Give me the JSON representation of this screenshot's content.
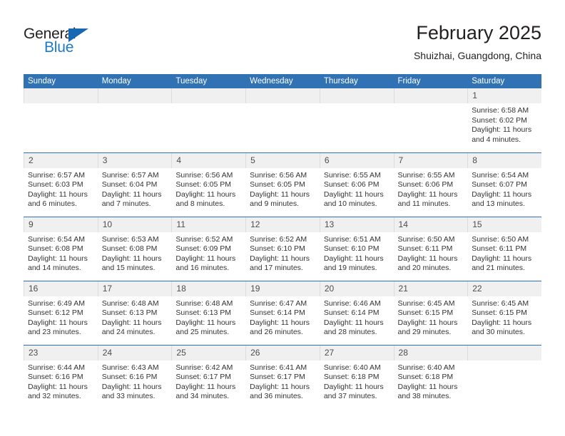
{
  "logo": {
    "word1": "General",
    "word2": "Blue",
    "triangle_color": "#1668b3",
    "blue_color": "#1c7ac9"
  },
  "header": {
    "title": "February 2025",
    "subtitle": "Shuizhai, Guangdong, China",
    "accent_color": "#3072b4"
  },
  "weekday_headers": [
    "Sunday",
    "Monday",
    "Tuesday",
    "Wednesday",
    "Thursday",
    "Friday",
    "Saturday"
  ],
  "weeks": [
    [
      {
        "day": "",
        "empty": true
      },
      {
        "day": "",
        "empty": true
      },
      {
        "day": "",
        "empty": true
      },
      {
        "day": "",
        "empty": true
      },
      {
        "day": "",
        "empty": true
      },
      {
        "day": "",
        "empty": true
      },
      {
        "day": "1",
        "sunrise": "Sunrise: 6:58 AM",
        "sunset": "Sunset: 6:02 PM",
        "daylight": "Daylight: 11 hours and 4 minutes."
      }
    ],
    [
      {
        "day": "2",
        "sunrise": "Sunrise: 6:57 AM",
        "sunset": "Sunset: 6:03 PM",
        "daylight": "Daylight: 11 hours and 6 minutes."
      },
      {
        "day": "3",
        "sunrise": "Sunrise: 6:57 AM",
        "sunset": "Sunset: 6:04 PM",
        "daylight": "Daylight: 11 hours and 7 minutes."
      },
      {
        "day": "4",
        "sunrise": "Sunrise: 6:56 AM",
        "sunset": "Sunset: 6:05 PM",
        "daylight": "Daylight: 11 hours and 8 minutes."
      },
      {
        "day": "5",
        "sunrise": "Sunrise: 6:56 AM",
        "sunset": "Sunset: 6:05 PM",
        "daylight": "Daylight: 11 hours and 9 minutes."
      },
      {
        "day": "6",
        "sunrise": "Sunrise: 6:55 AM",
        "sunset": "Sunset: 6:06 PM",
        "daylight": "Daylight: 11 hours and 10 minutes."
      },
      {
        "day": "7",
        "sunrise": "Sunrise: 6:55 AM",
        "sunset": "Sunset: 6:06 PM",
        "daylight": "Daylight: 11 hours and 11 minutes."
      },
      {
        "day": "8",
        "sunrise": "Sunrise: 6:54 AM",
        "sunset": "Sunset: 6:07 PM",
        "daylight": "Daylight: 11 hours and 13 minutes."
      }
    ],
    [
      {
        "day": "9",
        "sunrise": "Sunrise: 6:54 AM",
        "sunset": "Sunset: 6:08 PM",
        "daylight": "Daylight: 11 hours and 14 minutes."
      },
      {
        "day": "10",
        "sunrise": "Sunrise: 6:53 AM",
        "sunset": "Sunset: 6:08 PM",
        "daylight": "Daylight: 11 hours and 15 minutes."
      },
      {
        "day": "11",
        "sunrise": "Sunrise: 6:52 AM",
        "sunset": "Sunset: 6:09 PM",
        "daylight": "Daylight: 11 hours and 16 minutes."
      },
      {
        "day": "12",
        "sunrise": "Sunrise: 6:52 AM",
        "sunset": "Sunset: 6:10 PM",
        "daylight": "Daylight: 11 hours and 17 minutes."
      },
      {
        "day": "13",
        "sunrise": "Sunrise: 6:51 AM",
        "sunset": "Sunset: 6:10 PM",
        "daylight": "Daylight: 11 hours and 19 minutes."
      },
      {
        "day": "14",
        "sunrise": "Sunrise: 6:50 AM",
        "sunset": "Sunset: 6:11 PM",
        "daylight": "Daylight: 11 hours and 20 minutes."
      },
      {
        "day": "15",
        "sunrise": "Sunrise: 6:50 AM",
        "sunset": "Sunset: 6:11 PM",
        "daylight": "Daylight: 11 hours and 21 minutes."
      }
    ],
    [
      {
        "day": "16",
        "sunrise": "Sunrise: 6:49 AM",
        "sunset": "Sunset: 6:12 PM",
        "daylight": "Daylight: 11 hours and 23 minutes."
      },
      {
        "day": "17",
        "sunrise": "Sunrise: 6:48 AM",
        "sunset": "Sunset: 6:13 PM",
        "daylight": "Daylight: 11 hours and 24 minutes."
      },
      {
        "day": "18",
        "sunrise": "Sunrise: 6:48 AM",
        "sunset": "Sunset: 6:13 PM",
        "daylight": "Daylight: 11 hours and 25 minutes."
      },
      {
        "day": "19",
        "sunrise": "Sunrise: 6:47 AM",
        "sunset": "Sunset: 6:14 PM",
        "daylight": "Daylight: 11 hours and 26 minutes."
      },
      {
        "day": "20",
        "sunrise": "Sunrise: 6:46 AM",
        "sunset": "Sunset: 6:14 PM",
        "daylight": "Daylight: 11 hours and 28 minutes."
      },
      {
        "day": "21",
        "sunrise": "Sunrise: 6:45 AM",
        "sunset": "Sunset: 6:15 PM",
        "daylight": "Daylight: 11 hours and 29 minutes."
      },
      {
        "day": "22",
        "sunrise": "Sunrise: 6:45 AM",
        "sunset": "Sunset: 6:15 PM",
        "daylight": "Daylight: 11 hours and 30 minutes."
      }
    ],
    [
      {
        "day": "23",
        "sunrise": "Sunrise: 6:44 AM",
        "sunset": "Sunset: 6:16 PM",
        "daylight": "Daylight: 11 hours and 32 minutes."
      },
      {
        "day": "24",
        "sunrise": "Sunrise: 6:43 AM",
        "sunset": "Sunset: 6:16 PM",
        "daylight": "Daylight: 11 hours and 33 minutes."
      },
      {
        "day": "25",
        "sunrise": "Sunrise: 6:42 AM",
        "sunset": "Sunset: 6:17 PM",
        "daylight": "Daylight: 11 hours and 34 minutes."
      },
      {
        "day": "26",
        "sunrise": "Sunrise: 6:41 AM",
        "sunset": "Sunset: 6:17 PM",
        "daylight": "Daylight: 11 hours and 36 minutes."
      },
      {
        "day": "27",
        "sunrise": "Sunrise: 6:40 AM",
        "sunset": "Sunset: 6:18 PM",
        "daylight": "Daylight: 11 hours and 37 minutes."
      },
      {
        "day": "28",
        "sunrise": "Sunrise: 6:40 AM",
        "sunset": "Sunset: 6:18 PM",
        "daylight": "Daylight: 11 hours and 38 minutes."
      },
      {
        "day": "",
        "empty": true
      }
    ]
  ]
}
